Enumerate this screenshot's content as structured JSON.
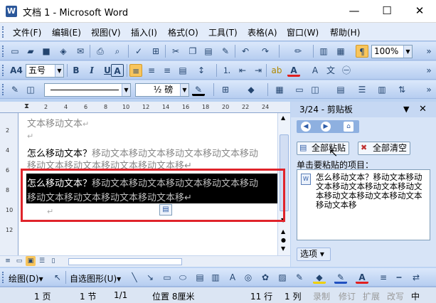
{
  "window": {
    "title": "文档 1 - Microsoft Word",
    "app_icon": "W",
    "minimize": "—",
    "maximize": "☐",
    "close": "✕"
  },
  "menu": {
    "items": [
      "文件(F)",
      "编辑(E)",
      "视图(V)",
      "插入(I)",
      "格式(O)",
      "工具(T)",
      "表格(A)",
      "窗口(W)",
      "帮助(H)"
    ]
  },
  "toolbar_standard": {
    "zoom": "100%"
  },
  "toolbar_format": {
    "style_symbol": "A4",
    "font_size": "五号",
    "bold": "B",
    "italic": "I",
    "underline": "U",
    "char_border": "A",
    "font_color": "A"
  },
  "toolbar_tables": {
    "line_weight": "½ 磅"
  },
  "ruler": {
    "h_ticks": [
      "2",
      "4",
      "6",
      "8",
      "10",
      "12",
      "14",
      "16",
      "18",
      "20",
      "22",
      "24"
    ],
    "v_ticks": [
      "2",
      "4",
      "6",
      "8",
      "10",
      "12"
    ]
  },
  "document": {
    "line1": "文本移动文本",
    "line1_mark": "↵",
    "line2_mark": "↵",
    "line3_black": "怎么移动文本？",
    "line3_grey": "移动文本移动文本移动文本移动文本移动",
    "line4": "移动文本移动文本移动文本移动文本移↵",
    "sel_line1_black": "怎么移动文本？",
    "sel_line1_grey": "移动文本移动文本移动文本移动文本移动",
    "sel_line2": "移动文本移动文本移动文本移动文本移↵",
    "after_sel_mark": "↵"
  },
  "pane": {
    "title": "3/24 - 剪贴板",
    "paste_all": "全部粘贴",
    "clear_all": "全部清空",
    "hint": "单击要粘贴的项目：",
    "item": "怎么移动文本？移动文本移动文本移动文本移动文本移动文本移动文本移动文本移动文本移动文本移",
    "options": "选项 ▾"
  },
  "drawbar": {
    "draw": "绘图(D)▾",
    "autoshape": "自选图形(U)▾"
  },
  "status": {
    "page": "1 页",
    "section": "1 节",
    "pages": "1/1",
    "position": "位置 8厘米",
    "line": "11 行",
    "col": "1 列",
    "rec": "录制",
    "track": "修订",
    "ext": "扩展",
    "ovr": "改写",
    "lang": "中"
  }
}
